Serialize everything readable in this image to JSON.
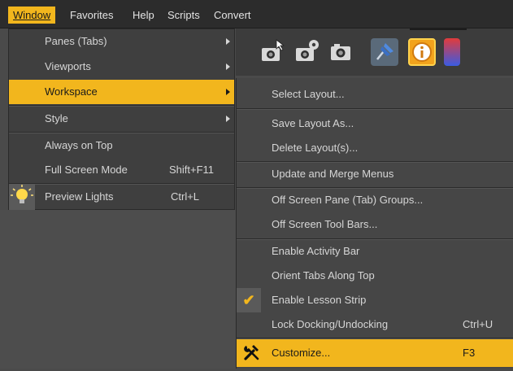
{
  "menubar": {
    "items": [
      {
        "label": "Window"
      },
      {
        "label": "Favorites"
      },
      {
        "label": "Help"
      },
      {
        "label": "Scripts"
      },
      {
        "label": "Convert"
      }
    ]
  },
  "window_menu": {
    "items": [
      {
        "label": "Panes (Tabs)",
        "submenu": true
      },
      {
        "label": "Viewports",
        "submenu": true
      },
      {
        "label": "Workspace",
        "submenu": true,
        "highlighted": true
      },
      {
        "label": "Style",
        "submenu": true
      },
      {
        "label": "Always on Top"
      },
      {
        "label": "Full Screen Mode",
        "shortcut": "Shift+F11"
      },
      {
        "label": "Preview Lights",
        "shortcut": "Ctrl+L",
        "icon": "lightbulb-icon"
      }
    ]
  },
  "workspace_menu": {
    "items": [
      {
        "label": "Select Layout..."
      },
      {
        "label": "Save Layout As..."
      },
      {
        "label": "Delete Layout(s)..."
      },
      {
        "label": "Update and Merge Menus"
      },
      {
        "label": "Off Screen Pane (Tab) Groups..."
      },
      {
        "label": "Off Screen Tool Bars..."
      },
      {
        "label": "Enable Activity Bar"
      },
      {
        "label": "Orient Tabs Along Top"
      },
      {
        "label": "Enable Lesson Strip",
        "checked": true
      },
      {
        "label": "Lock Docking/Undocking",
        "shortcut": "Ctrl+U"
      },
      {
        "label": "Customize...",
        "shortcut": "F3",
        "highlighted": true,
        "icon": "tools-icon"
      }
    ]
  },
  "toolbar": {
    "icons": [
      "camera-arrow-icon",
      "camera-gear-icon",
      "camera-icon",
      "pin-icon",
      "info-icon",
      "color-icon"
    ]
  },
  "colors": {
    "accent": "#f2b61d",
    "menu_bg": "#3f3f3f",
    "submenu_bg": "#464646",
    "menubar_bg": "#2c2c2c",
    "text": "#d6d6d6"
  }
}
